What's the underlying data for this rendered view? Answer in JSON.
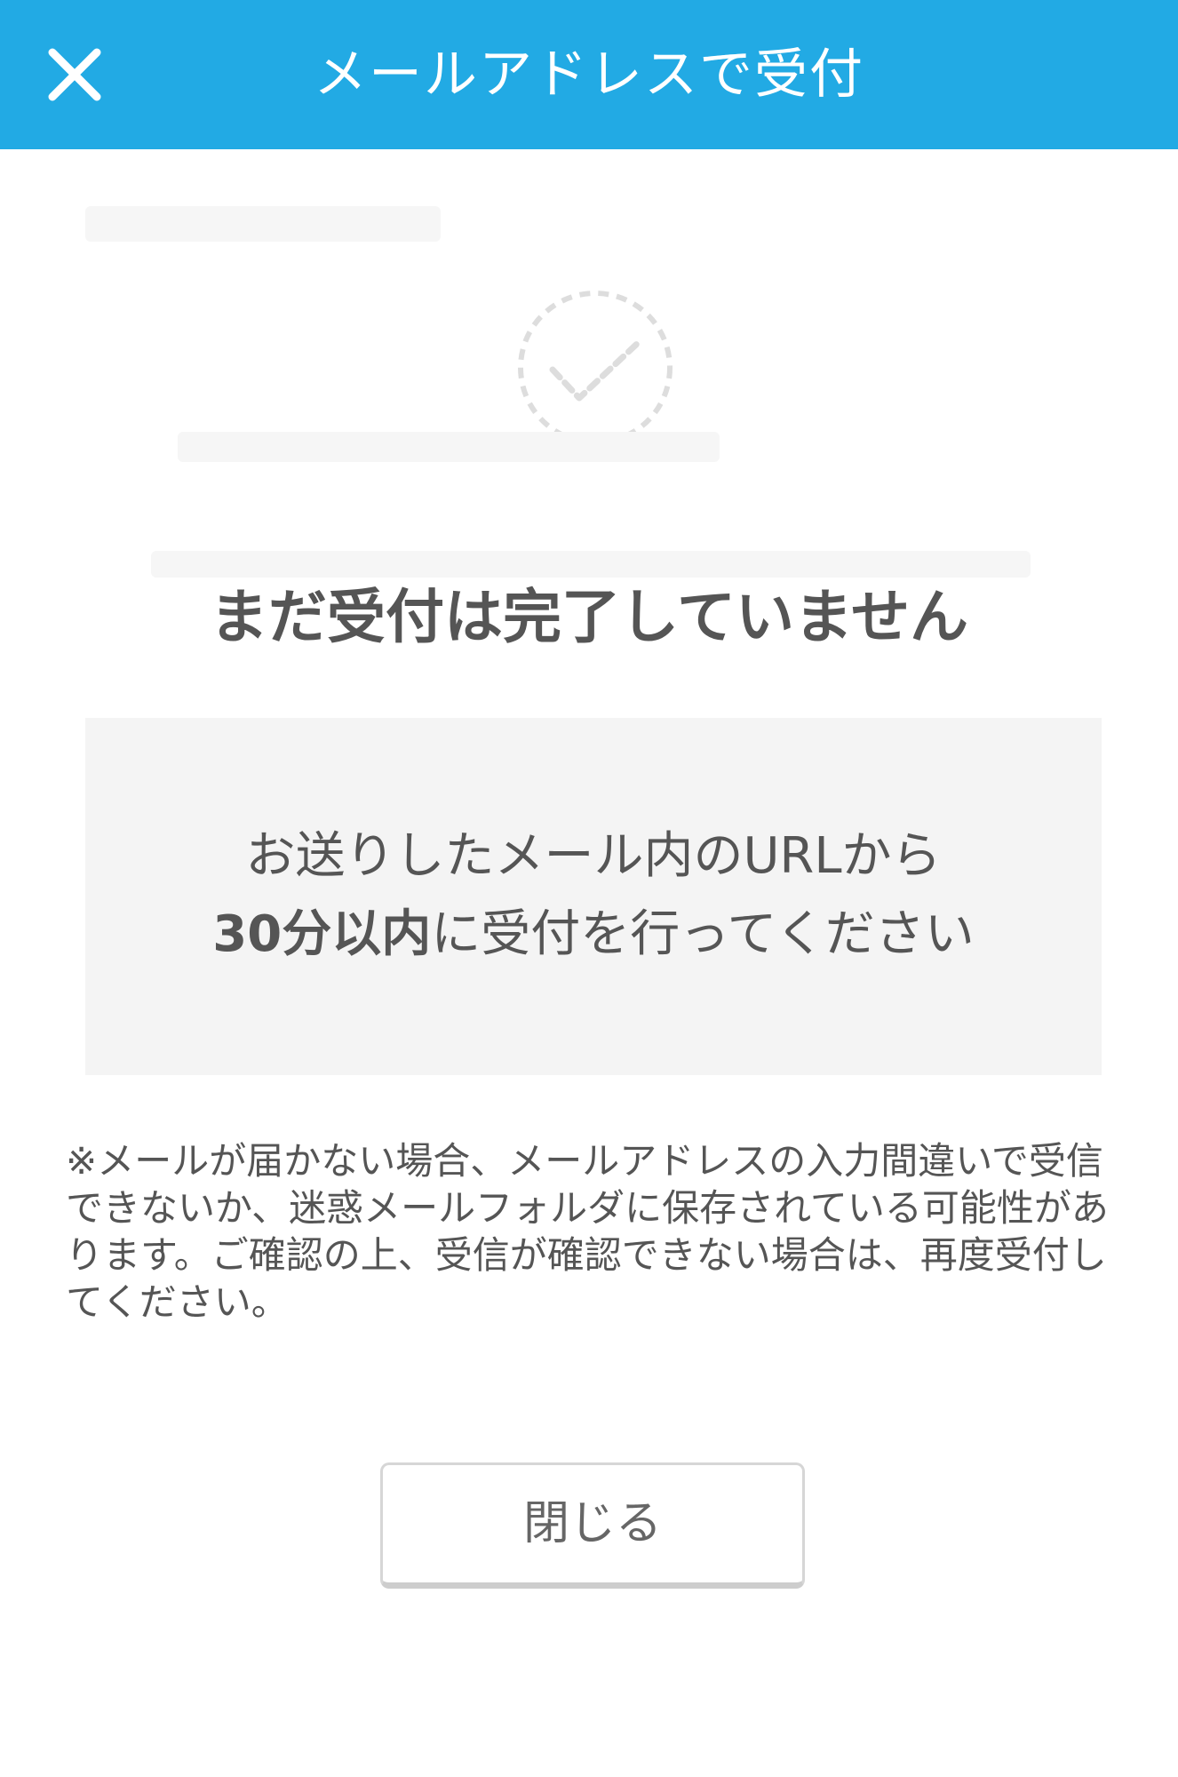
{
  "header": {
    "title": "メールアドレスで受付",
    "close_icon": "close-icon",
    "background_color": "#22aae4"
  },
  "background_page": {
    "check_icon": "dashed-check-circle-icon"
  },
  "dialog": {
    "message": "まだ受付は完了していません",
    "info": {
      "line1": "お送りしたメール内のURLから",
      "line2_emphasis": "30分以内",
      "line2_rest": "に受付を行ってください"
    },
    "note": "※メールが届かない場合、メールアドレスの入力間違いで受信できないか、迷惑メールフォルダに保存されている可能性があります。ご確認の上、受信が確認できない場合は、再度受付してください。",
    "close_button_label": "閉じる"
  }
}
